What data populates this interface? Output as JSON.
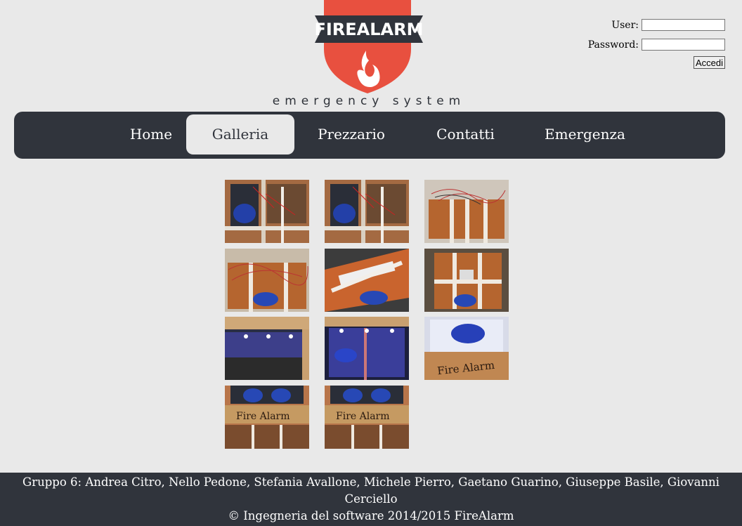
{
  "header": {
    "logo_text": "FIREALARM",
    "tagline": "emergency system"
  },
  "login": {
    "user_label": "User:",
    "password_label": "Password:",
    "submit_label": "Accedi",
    "user_value": "",
    "password_value": ""
  },
  "nav": {
    "items": [
      {
        "label": "Home",
        "active": false
      },
      {
        "label": "Galleria",
        "active": true
      },
      {
        "label": "Prezzario",
        "active": false
      },
      {
        "label": "Contatti",
        "active": false
      },
      {
        "label": "Emergenza",
        "active": false
      }
    ]
  },
  "gallery": {
    "images": [
      {
        "alt": "photo-1"
      },
      {
        "alt": "photo-2"
      },
      {
        "alt": "photo-3"
      },
      {
        "alt": "photo-4"
      },
      {
        "alt": "photo-5"
      },
      {
        "alt": "photo-6"
      },
      {
        "alt": "photo-7"
      },
      {
        "alt": "photo-8"
      },
      {
        "alt": "photo-9"
      },
      {
        "alt": "photo-10"
      },
      {
        "alt": "photo-11"
      }
    ],
    "sign_text": "Fire Alarm"
  },
  "footer": {
    "line1": "Gruppo 6: Andrea Citro, Nello Pedone, Stefania Avallone, Michele Pierro, Gaetano Guarino, Giuseppe Basile, Giovanni Cerciello",
    "line2": "© Ingegneria del software 2014/2015 FireAlarm"
  },
  "colors": {
    "background": "#e9e9e9",
    "nav_bg": "#30343c",
    "logo_red": "#e8503f",
    "logo_banner": "#30343c"
  }
}
